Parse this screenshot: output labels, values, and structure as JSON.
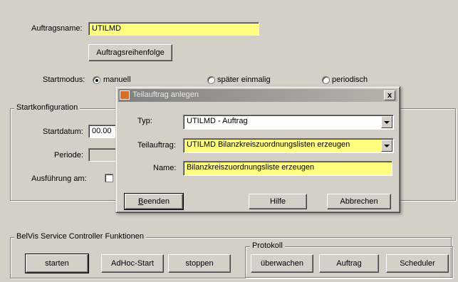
{
  "main": {
    "auftragsname_label": "Auftragsname:",
    "auftragsname_value": "UTILMD",
    "auftragsreihenfolge_button": "Auftragsreihenfolge",
    "startmodus_label": "Startmodus:",
    "startmodus_options": [
      "manuell",
      "später einmalig",
      "periodisch"
    ],
    "startmodus_selected": "manuell"
  },
  "startkonfiguration": {
    "title": "Startkonfiguration",
    "startdatum_label": "Startdatum:",
    "startdatum_value": "00.00",
    "periode_label": "Periode:",
    "ausfuehrung_label": "Ausführung am:"
  },
  "controller": {
    "title": "BelVis Service Controller Funktionen",
    "buttons": [
      "starten",
      "AdHoc-Start",
      "stoppen"
    ]
  },
  "protokoll": {
    "title": "Protokoll",
    "buttons": [
      "überwachen",
      "Auftrag",
      "Scheduler"
    ]
  },
  "dialog": {
    "title": "Teilauftrag anlegen",
    "typ_label": "Typ:",
    "typ_value": "UTILMD - Auftrag",
    "teilauftrag_label": "Teilauftrag:",
    "teilauftrag_value": "UTILMD Bilanzkreiszuordnungslisten erzeugen",
    "name_label": "Name:",
    "name_value": "Bilanzkreiszuordnungsliste erzeugen",
    "beenden_first": "B",
    "beenden_rest": "eenden",
    "hilfe_button": "Hilfe",
    "abbrechen_button": "Abbrechen",
    "close_glyph": "x"
  },
  "colors": {
    "window_bg": "#d4d0c8",
    "highlight_field": "#ffff80",
    "titlebar_inactive": "#808080"
  }
}
